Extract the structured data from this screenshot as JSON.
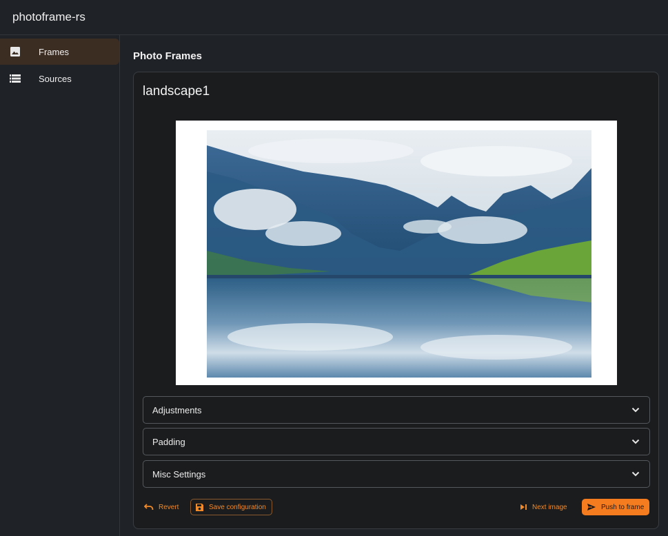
{
  "app": {
    "title": "photoframe-rs"
  },
  "sidebar": {
    "items": [
      {
        "label": "Frames",
        "icon": "image-icon",
        "active": true
      },
      {
        "label": "Sources",
        "icon": "list-icon",
        "active": false
      }
    ]
  },
  "page": {
    "title": "Photo Frames"
  },
  "frame": {
    "name": "landscape1",
    "sections": [
      {
        "label": "Adjustments",
        "icon": "chevron-down-icon"
      },
      {
        "label": "Padding",
        "icon": "chevron-down-icon"
      },
      {
        "label": "Misc Settings",
        "icon": "chevron-down-icon"
      }
    ],
    "actions": {
      "revert": "Revert",
      "save": "Save configuration",
      "next": "Next image",
      "push": "Push to frame"
    }
  },
  "colors": {
    "accent": "#f57c1f",
    "accent_text": "#f08a2a",
    "background": "#1f2226",
    "card": "#1b1c1e",
    "active_nav": "#3c2d22"
  }
}
